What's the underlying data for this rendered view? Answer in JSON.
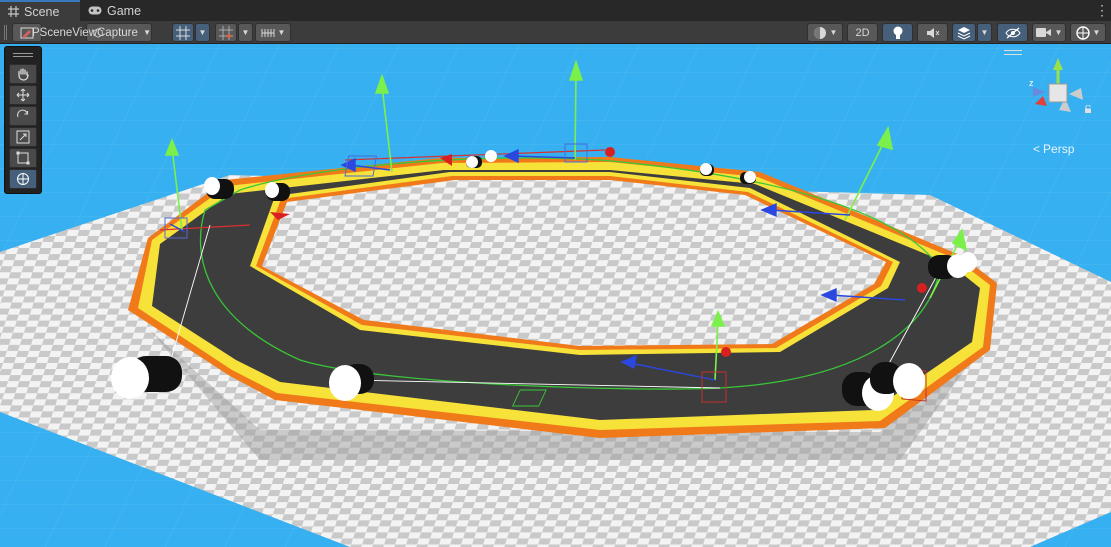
{
  "tabs": [
    {
      "label": "Scene",
      "icon": "grid-icon",
      "active": true
    },
    {
      "label": "Game",
      "icon": "gamepad-icon",
      "active": false
    }
  ],
  "toolbar": {
    "overlay_label": "PSceneViewCapture",
    "two_d_label": "2D",
    "accent": "#46607c"
  },
  "tools": [
    "hand-tool",
    "move-tool",
    "rotate-tool",
    "scale-tool",
    "rect-tool",
    "transform-tool"
  ],
  "gizmo": {
    "projection_label": "Persp",
    "x_color": "#e0403a",
    "y_color": "#9ae04a",
    "z_color": "#3a7ae0"
  },
  "scene": {
    "sky_color": "#36b0f0",
    "track_color": "#3a3a3a",
    "border_yellow": "#f7e23a",
    "border_orange": "#f07a1a",
    "spline_color": "#39c739"
  }
}
